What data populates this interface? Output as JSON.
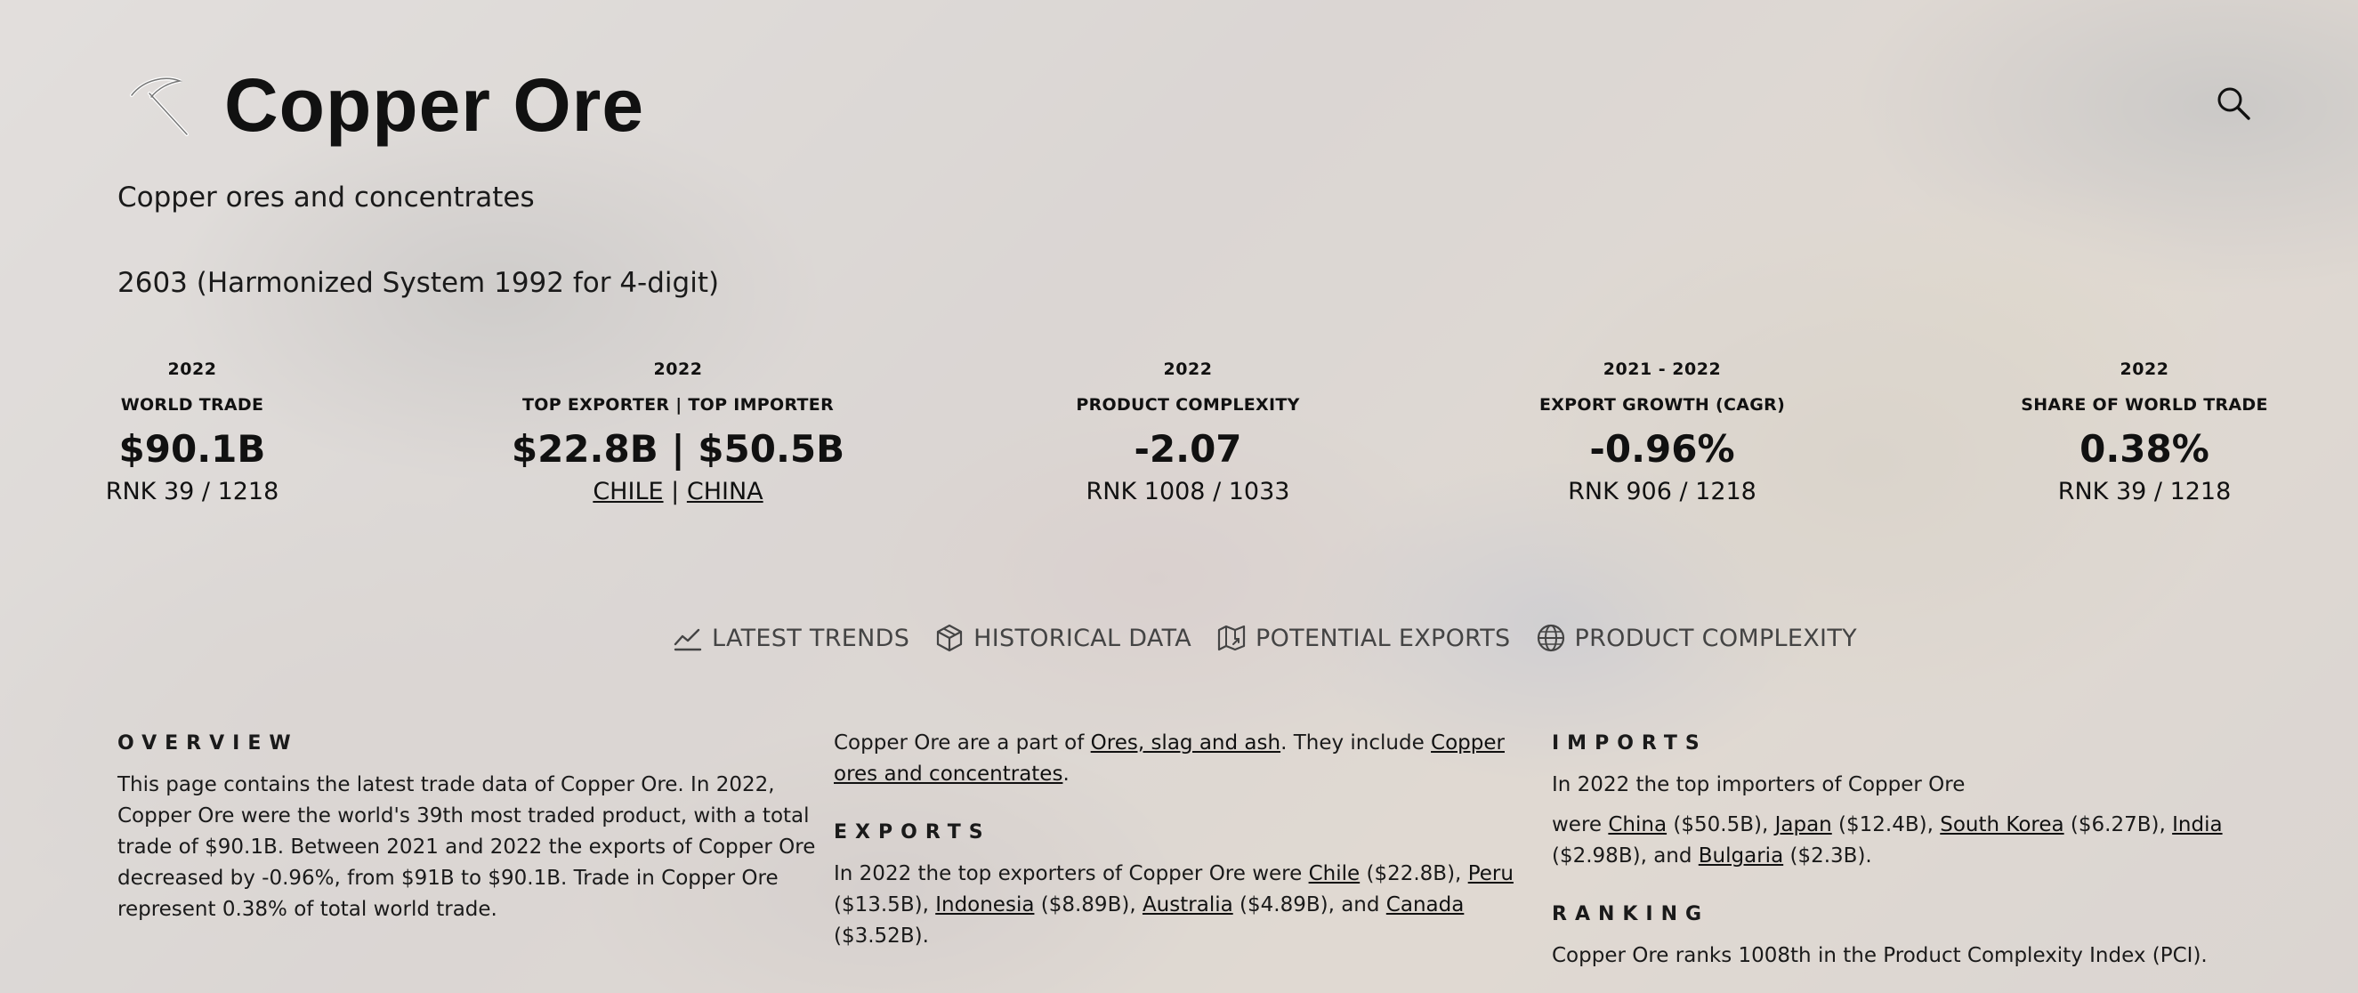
{
  "header": {
    "title": "Copper Ore",
    "subtitle": "Copper ores and concentrates",
    "hs_code": "2603 (Harmonized System 1992 for 4-digit)"
  },
  "stats": [
    {
      "year": "2022",
      "label": "WORLD TRADE",
      "value": "$90.1B",
      "rank": "RNK 39 / 1218"
    },
    {
      "year": "2022",
      "label": "TOP EXPORTER | TOP IMPORTER",
      "value": "$22.8B | $50.5B",
      "exporter": "CHILE",
      "separator": "|",
      "importer": "CHINA"
    },
    {
      "year": "2022",
      "label": "PRODUCT COMPLEXITY",
      "value": "-2.07",
      "rank": "RNK 1008 / 1033"
    },
    {
      "year": "2021 - 2022",
      "label": "EXPORT GROWTH (CAGR)",
      "value": "-0.96%",
      "rank": "RNK 906 / 1218"
    },
    {
      "year": "2022",
      "label": "SHARE OF WORLD TRADE",
      "value": "0.38%",
      "rank": "RNK 39 / 1218"
    }
  ],
  "tabs": [
    {
      "label": "LATEST TRENDS",
      "icon": "trend-icon"
    },
    {
      "label": "HISTORICAL DATA",
      "icon": "cube-icon"
    },
    {
      "label": "POTENTIAL EXPORTS",
      "icon": "map-icon"
    },
    {
      "label": "PRODUCT COMPLEXITY",
      "icon": "globe-icon"
    }
  ],
  "overview": {
    "heading": "OVERVIEW",
    "text": "This page contains the latest trade data of Copper Ore. In 2022, Copper Ore were the world's 39th most traded product, with a total trade of $90.1B. Between 2021 and 2022 the exports of Copper Ore decreased by -0.96%, from $91B to $90.1B. Trade in Copper Ore represent 0.38% of total world trade."
  },
  "part_of": {
    "t1": "Copper Ore are a part of ",
    "link1": "Ores, slag and ash",
    "t2": ". They include ",
    "link2": "Copper ores and concentrates",
    "t3": "."
  },
  "exports": {
    "heading": "EXPORTS",
    "intro": "In 2022 the top exporters of Copper Ore  were ",
    "items": [
      {
        "name": "Chile",
        "value": " ($22.8B), "
      },
      {
        "name": "Peru",
        "value": " ($13.5B), "
      },
      {
        "name": "Indonesia",
        "value": " ($8.89B), "
      },
      {
        "name": "Australia",
        "value": " ($4.89B), and "
      },
      {
        "name": "Canada",
        "value": " ($3.52B)."
      }
    ]
  },
  "imports": {
    "heading": "IMPORTS",
    "intro": "In 2022 the top importers of Copper Ore",
    "lead": "were ",
    "items": [
      {
        "name": "China",
        "value": " ($50.5B), "
      },
      {
        "name": "Japan",
        "value": " ($12.4B), "
      },
      {
        "name": "South Korea",
        "value": " ($6.27B), "
      },
      {
        "name": "India",
        "value": " ($2.98B), and "
      },
      {
        "name": "Bulgaria",
        "value": " ($2.3B)."
      }
    ]
  },
  "ranking": {
    "heading": "RANKING",
    "text": "Copper Ore ranks 1008th in the Product Complexity Index (PCI)."
  }
}
